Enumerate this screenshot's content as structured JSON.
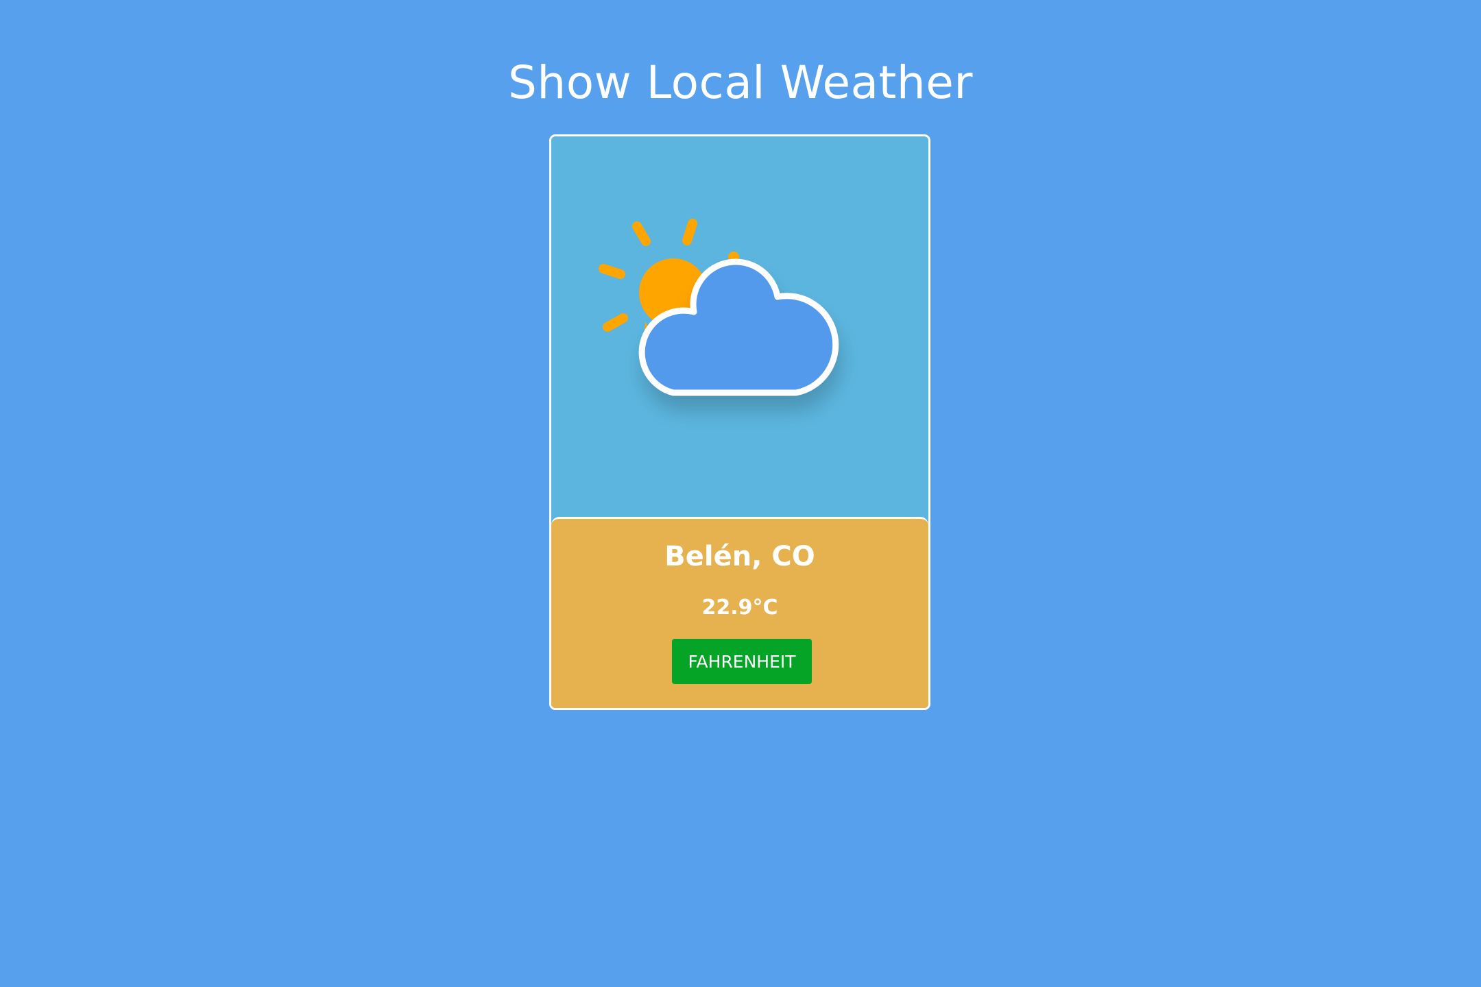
{
  "page": {
    "title": "Show Local Weather"
  },
  "weather": {
    "icon": "partly-cloudy-icon",
    "location": "Belén, CO",
    "temperature": "22.9°C",
    "unit_button_label": "FAHRENHEIT"
  },
  "colors": {
    "background": "#57a0ed",
    "card_top": "#5bb5de",
    "info_panel": "#e6b24f",
    "button": "#05a326",
    "sun": "#ffa500",
    "cloud_fill": "#5399ec",
    "cloud_outline": "#ffffff"
  }
}
